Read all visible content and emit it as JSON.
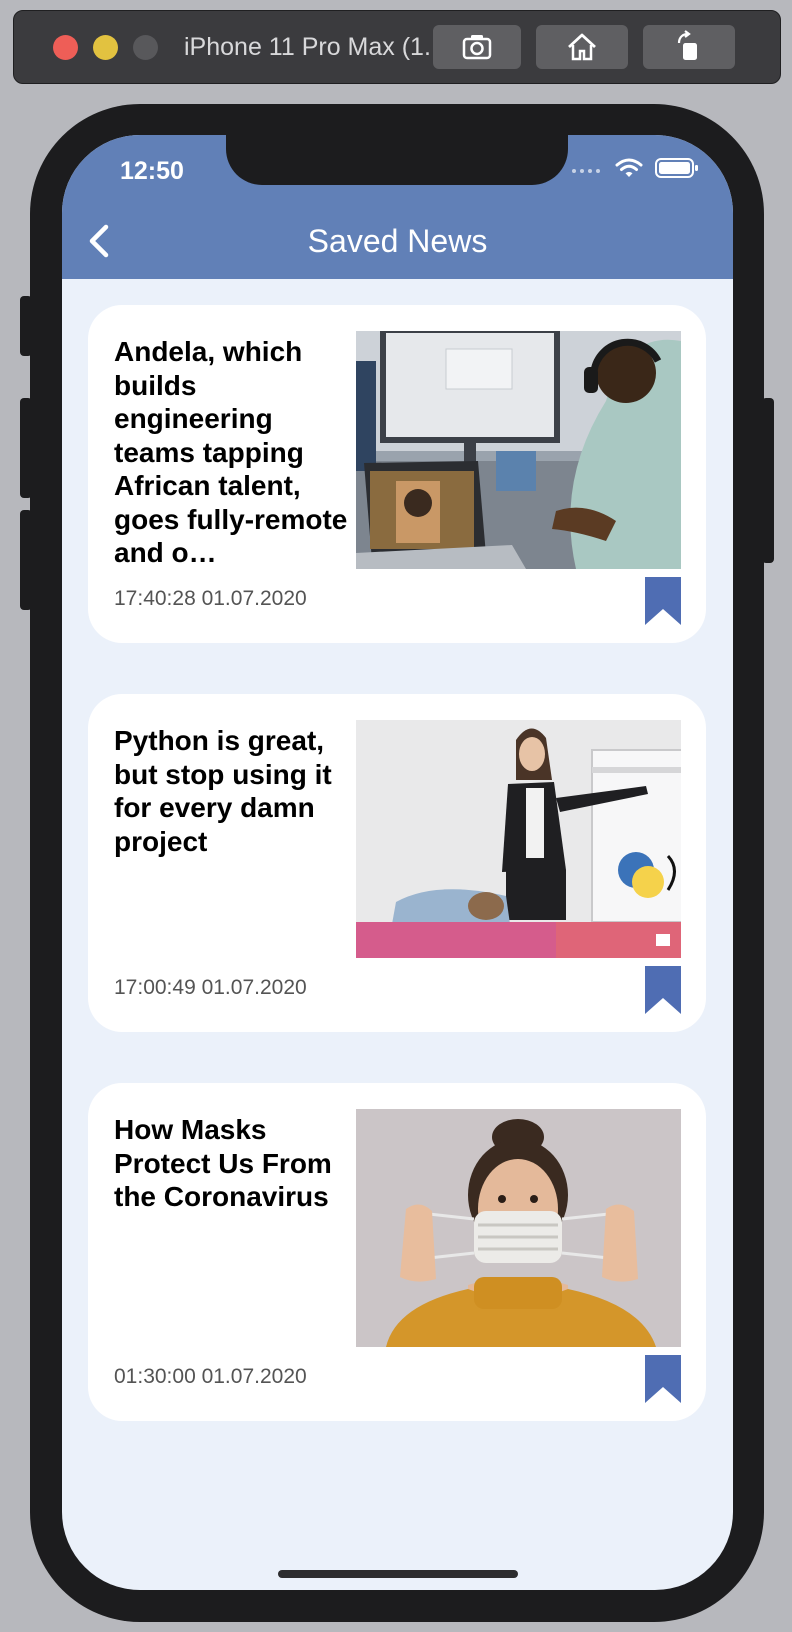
{
  "simulator": {
    "window_title": "iPhone 11 Pro Max (1...",
    "buttons": [
      "screenshot-icon",
      "home-icon",
      "rotate-icon"
    ]
  },
  "status_bar": {
    "time": "12:50",
    "icons": [
      "signal-icon",
      "wifi-icon",
      "battery-icon"
    ]
  },
  "nav": {
    "back_icon": "chevron-left-icon",
    "title": "Saved News",
    "bar_color": "#6180b7"
  },
  "colors": {
    "background": "#ebf1fa",
    "bookmark": "#4f6db3"
  },
  "articles": [
    {
      "title": "Andela, which builds engineering teams tapping African talent, goes fully-remote and o…",
      "timestamp": "17:40:28 01.07.2020",
      "image": "office-video-call-photo",
      "bookmarked": true
    },
    {
      "title": "Python is great, but stop using it for every damn project",
      "timestamp": "17:00:49 01.07.2020",
      "image": "python-presentation-photo",
      "bookmarked": true
    },
    {
      "title": "How Masks Protect Us From the Coronavirus",
      "timestamp": "01:30:00 01.07.2020",
      "image": "woman-face-mask-photo",
      "bookmarked": true
    }
  ]
}
